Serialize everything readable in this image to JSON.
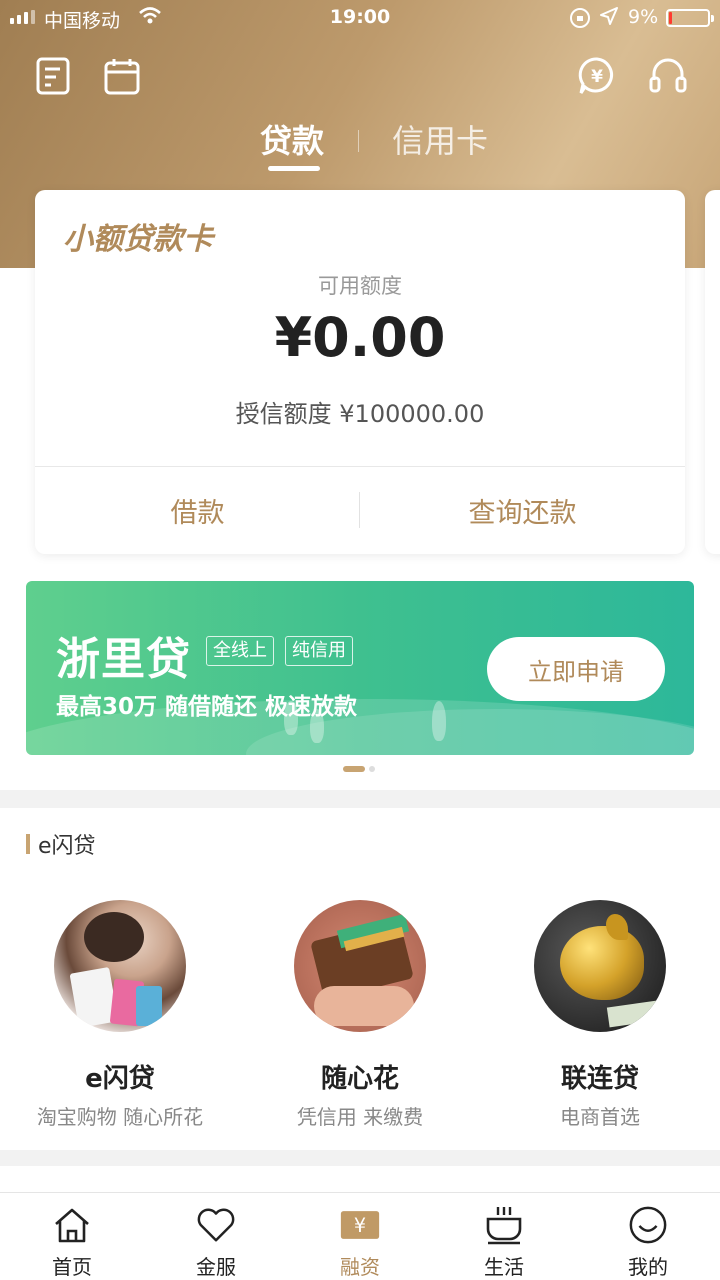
{
  "status_bar": {
    "carrier": "中国移动",
    "time": "19:00",
    "battery_percent": "9%",
    "battery_level": 0.09,
    "icons": [
      "signal-icon",
      "wifi-icon",
      "orientation-lock-icon",
      "location-icon",
      "battery-icon"
    ]
  },
  "header": {
    "left_icons": [
      "bill-icon",
      "calendar-icon"
    ],
    "right_icons": [
      "yuan-chat-icon",
      "headset-icon"
    ],
    "tabs": [
      {
        "label": "贷款",
        "active": true
      },
      {
        "label": "信用卡",
        "active": false
      }
    ]
  },
  "loan_card": {
    "title": "小额贷款卡",
    "available_label": "可用额度",
    "available_amount": "¥0.00",
    "credit_line": "授信额度 ¥100000.00",
    "borrow_button": "借款",
    "repay_button": "查询还款"
  },
  "banner": {
    "title": "浙里贷",
    "tags": [
      "全线上",
      "纯信用"
    ],
    "subtitle": "最高30万 随借随还 极速放款",
    "apply_button": "立即申请",
    "colors": {
      "start": "#5fcf8e",
      "end": "#2db89a"
    }
  },
  "carousel": {
    "active_index": 0,
    "count": 2
  },
  "section_eflash": {
    "title": "e闪贷",
    "products": [
      {
        "name": "e闪贷",
        "desc": "淘宝购物 随心所花",
        "image": "shopping-woman-photo"
      },
      {
        "name": "随心花",
        "desc": "凭信用 来缴费",
        "image": "wallet-photo"
      },
      {
        "name": "联连贷",
        "desc": "电商首选",
        "image": "golden-piggy-bank-photo"
      }
    ]
  },
  "bottom_nav": [
    {
      "label": "首页",
      "icon": "home-icon",
      "active": false
    },
    {
      "label": "金服",
      "icon": "heart-icon",
      "active": false
    },
    {
      "label": "融资",
      "icon": "yuan-tag-icon",
      "active": true
    },
    {
      "label": "生活",
      "icon": "coffee-cup-icon",
      "active": false
    },
    {
      "label": "我的",
      "icon": "smile-icon",
      "active": false
    }
  ],
  "colors": {
    "accent": "#b08a5a",
    "header_gold": "#bd9a6c"
  }
}
